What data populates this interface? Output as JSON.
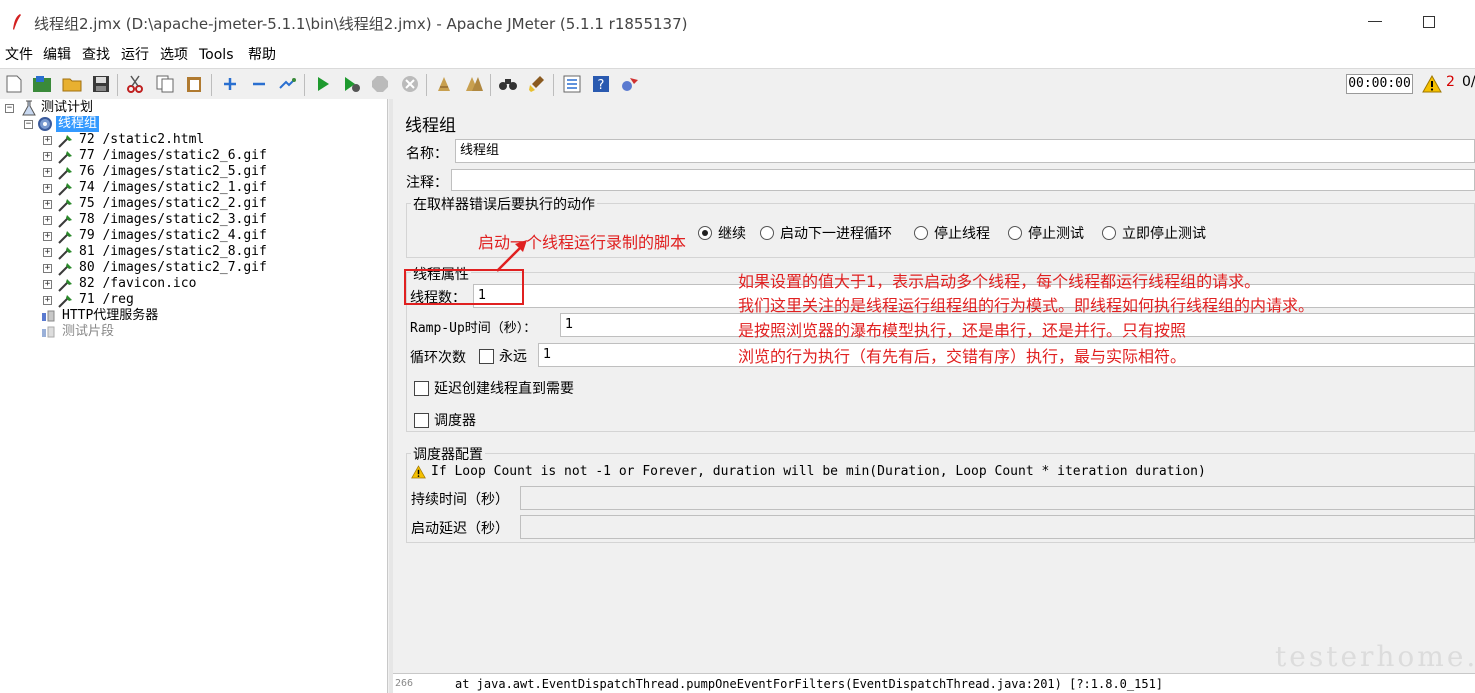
{
  "window": {
    "title": "线程组2.jmx (D:\\apache-jmeter-5.1.1\\bin\\线程组2.jmx) - Apache JMeter (5.1.1 r1855137)"
  },
  "menu": [
    "文件",
    "编辑",
    "查找",
    "运行",
    "选项",
    "Tools",
    "帮助"
  ],
  "toolbar": {
    "timer": "00:00:00",
    "warning_count": "2",
    "error_count": "0/"
  },
  "tree": {
    "root": "测试计划",
    "thread_group": "线程组",
    "samplers": [
      "72 /static2.html",
      "77 /images/static2_6.gif",
      "76 /images/static2_5.gif",
      "74 /images/static2_1.gif",
      "75 /images/static2_2.gif",
      "78 /images/static2_3.gif",
      "79 /images/static2_4.gif",
      "81 /images/static2_8.gif",
      "80 /images/static2_7.gif",
      "82 /favicon.ico",
      "71 /reg"
    ],
    "proxy": "HTTP代理服务器",
    "fragment": "测试片段"
  },
  "panel": {
    "title": "线程组",
    "name_label": "名称：",
    "name_value": "线程组",
    "comment_label": "注释：",
    "comment_value": "",
    "error_action_title": "在取样器错误后要执行的动作",
    "error_actions": [
      "继续",
      "启动下一进程循环",
      "停止线程",
      "停止测试",
      "立即停止测试"
    ],
    "selected_error_action": "继续",
    "thread_props_title": "线程属性",
    "threads_label": "线程数：",
    "threads_value": "1",
    "rampup_label": "Ramp-Up时间（秒）：",
    "rampup_value": "1",
    "loop_label": "循环次数",
    "forever_label": "永远",
    "loop_value": "1",
    "delay_label": "延迟创建线程直到需要",
    "scheduler_label": "调度器",
    "scheduler_config_title": "调度器配置",
    "scheduler_info": "If Loop Count is not -1 or Forever, duration will be min(Duration, Loop Count * iteration duration)",
    "duration_label": "持续时间（秒）",
    "duration_value": "",
    "startup_delay_label": "启动延迟（秒）",
    "startup_delay_value": ""
  },
  "annotations": {
    "arrow_text": "启动一个线程运行录制的脚本",
    "lines": [
      "如果设置的值大于1，表示启动多个线程，每个线程都运行线程组的请求。",
      "我们这里关注的是线程运行组程组的行为模式。即线程如何执行线程组的内请求。",
      "是按照浏览器的瀑布模型执行，还是串行，还是并行。只有按照",
      "浏览的行为执行（有先有后，交错有序）执行，最与实际相符。"
    ],
    "color": "#e02020"
  },
  "log": {
    "line_number": "266",
    "text": "at java.awt.EventDispatchThread.pumpOneEventForFilters(EventDispatchThread.java:201) [?:1.8.0_151]"
  },
  "watermark": "testerhome.com"
}
